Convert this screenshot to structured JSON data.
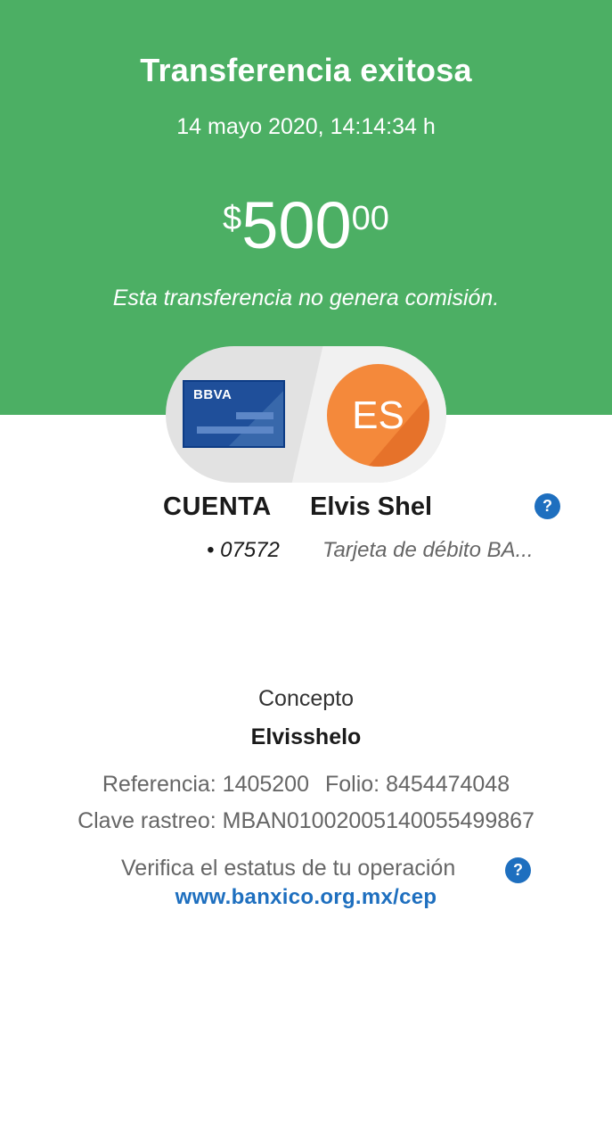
{
  "header": {
    "title": "Transferencia exitosa",
    "datetime": "14 mayo 2020, 14:14:34 h",
    "amount": {
      "currency": "$",
      "whole": "500",
      "cents": "00"
    },
    "note": "Esta transferencia no genera comisión."
  },
  "origin": {
    "card_logo": "BBVA",
    "label": "CUENTA",
    "number": "• 07572"
  },
  "payee": {
    "initials": "ES",
    "name": "Elvis Shel",
    "card": "Tarjeta de débito BA..."
  },
  "details": {
    "concept_label": "Concepto",
    "concept_value": "Elvisshelo",
    "reference": "Referencia: 1405200",
    "folio": "Folio: 8454474048",
    "tracking": "Clave rastreo: MBAN01002005140055499867"
  },
  "verify": {
    "text": "Verifica el estatus de tu operación",
    "link": "www.banxico.org.mx/cep"
  },
  "icons": {
    "help": "?"
  },
  "colors": {
    "header_green": "#4caf64",
    "link_blue": "#1e6fbf",
    "card_blue": "#1f4f9a",
    "avatar_orange": "#f4893b"
  }
}
